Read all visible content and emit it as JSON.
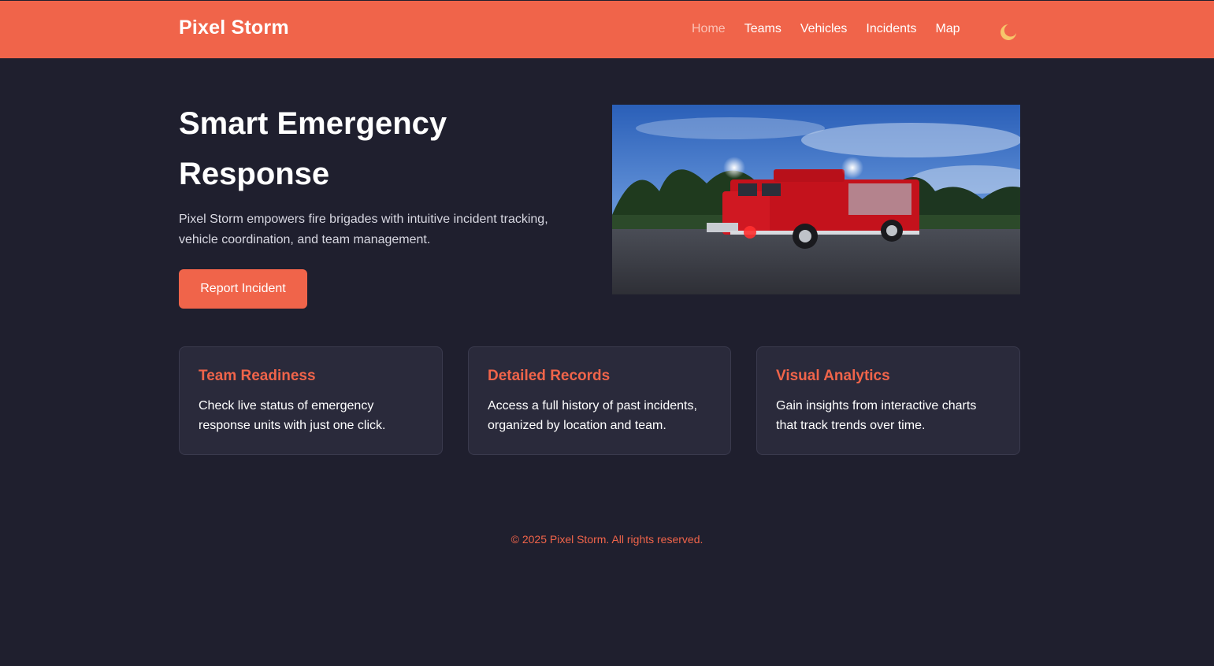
{
  "navbar": {
    "brand": "Pixel Storm",
    "links": [
      {
        "label": "Home",
        "active": true
      },
      {
        "label": "Teams",
        "active": false
      },
      {
        "label": "Vehicles",
        "active": false
      },
      {
        "label": "Incidents",
        "active": false
      },
      {
        "label": "Map",
        "active": false
      }
    ],
    "theme_toggle_icon": "moon-icon"
  },
  "hero": {
    "title": "Smart Emergency Response",
    "description": "Pixel Storm empowers fire brigades with intuitive incident tracking, vehicle coordination, and team management.",
    "button_label": "Report Incident",
    "image_subject": "fire-truck-image"
  },
  "cards": [
    {
      "title": "Team Readiness",
      "text": "Check live status of emergency response units with just one click."
    },
    {
      "title": "Detailed Records",
      "text": "Access a full history of past incidents, organized by location and team."
    },
    {
      "title": "Visual Analytics",
      "text": "Gain insights from interactive charts that track trends over time."
    }
  ],
  "footer": {
    "text": "© 2025 Pixel Storm. All rights reserved."
  },
  "colors": {
    "accent": "#f0644a",
    "background": "#1f1f2e",
    "card_background": "#2a2a3b",
    "moon": "#f7c66b"
  }
}
